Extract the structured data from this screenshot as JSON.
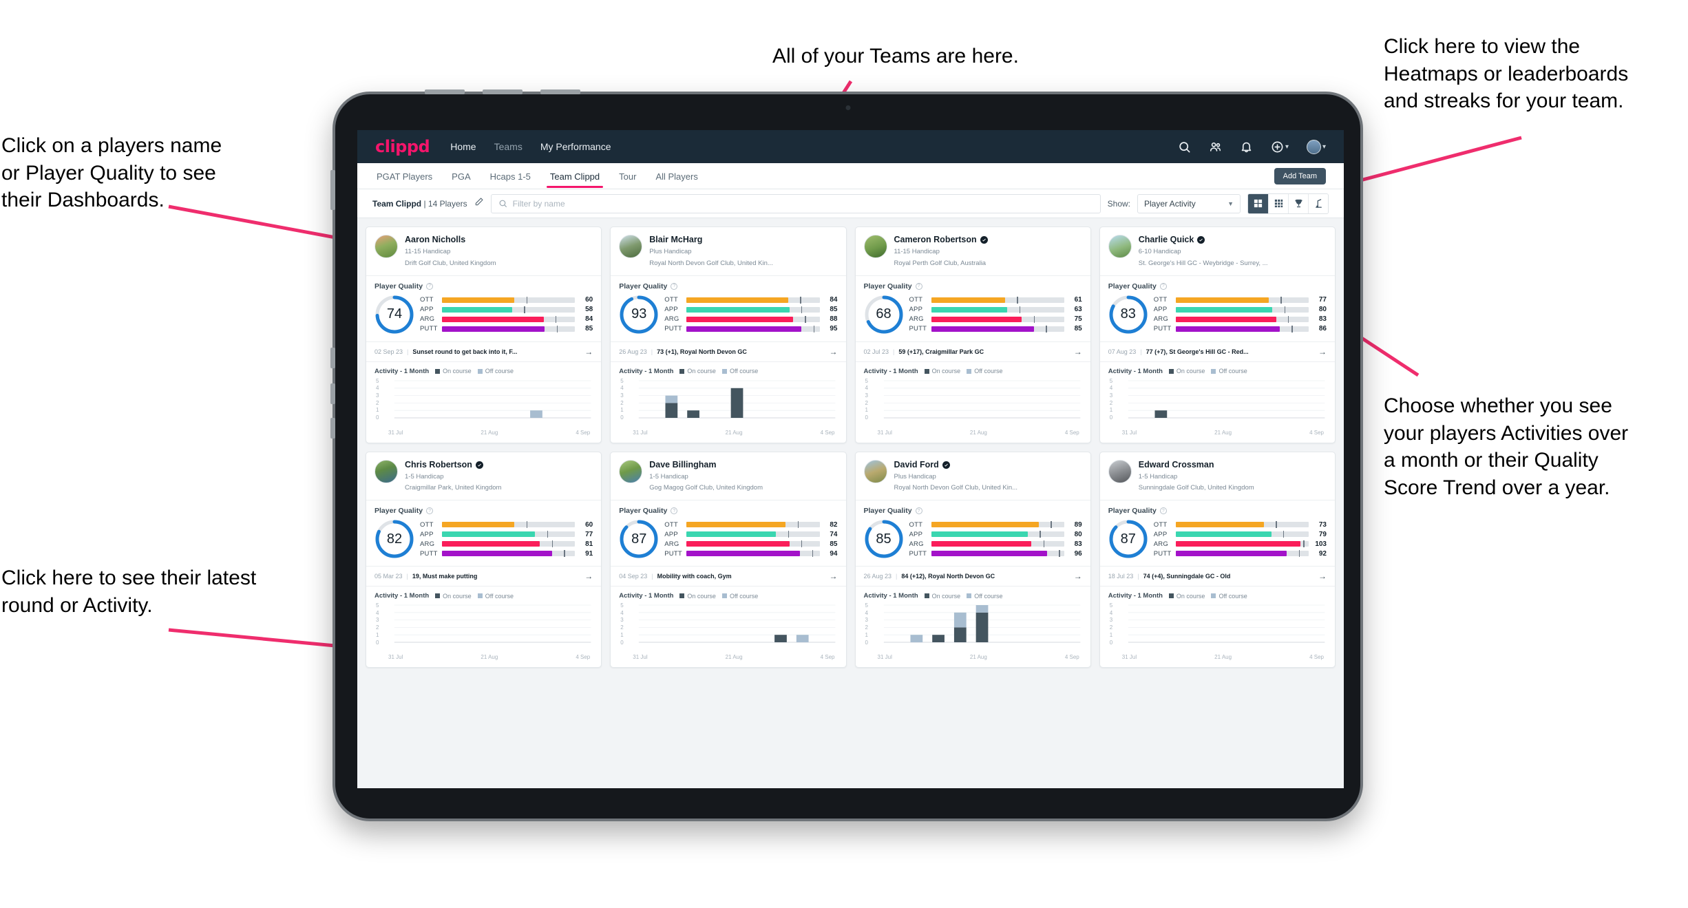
{
  "annotations": {
    "top": "All of your Teams are here.",
    "top_right": "Click here to view the\nHeatmaps or leaderboards\nand streaks for your team.",
    "top_left": "Click on a players name\nor Player Quality to see\ntheir Dashboards.",
    "bottom_left": "Click here to see their latest\nround or Activity.",
    "right": "Choose whether you see\nyour players Activities over\na month or their Quality\nScore Trend over a year.",
    "accent_color": "#ef2d6d"
  },
  "navbar": {
    "logo": "clippd",
    "links": [
      {
        "label": "Home",
        "active": true
      },
      {
        "label": "Teams",
        "active": false
      },
      {
        "label": "My Performance",
        "active": true
      }
    ],
    "icons": [
      "search-icon",
      "people-icon",
      "bell-icon",
      "plus-circle-icon",
      "avatar"
    ]
  },
  "tabs": [
    {
      "label": "PGAT Players",
      "active": false
    },
    {
      "label": "PGA",
      "active": false
    },
    {
      "label": "Hcaps 1-5",
      "active": false
    },
    {
      "label": "Team Clippd",
      "active": true
    },
    {
      "label": "Tour",
      "active": false
    },
    {
      "label": "All Players",
      "active": false
    }
  ],
  "add_team_label": "Add Team",
  "filterbar": {
    "team_name": "Team Clippd",
    "team_count": "| 14 Players",
    "search_placeholder": "Filter by name",
    "show_label": "Show:",
    "show_value": "Player Activity",
    "views": [
      {
        "name": "grid-view-icon",
        "active": true
      },
      {
        "name": "compact-grid-view-icon",
        "active": false
      },
      {
        "name": "trophy-view-icon",
        "active": false
      },
      {
        "name": "golfer-view-icon",
        "active": false
      }
    ]
  },
  "quality_section": {
    "title": "Player Quality",
    "metric_labels": [
      "OTT",
      "APP",
      "ARG",
      "PUTT"
    ],
    "metric_colors": [
      "#f5a623",
      "#3ad6b0",
      "#fa1e5a",
      "#a312c9"
    ]
  },
  "activity_section": {
    "title": "Activity - 1 Month",
    "legend_on": "On course",
    "legend_off": "Off course",
    "y_ticks": [
      "5",
      "4",
      "3",
      "2",
      "1",
      "0"
    ],
    "x_ticks": [
      "31 Jul",
      "21 Aug",
      "4 Sep"
    ],
    "color_on": "#44555f",
    "color_off": "#a8bdd0"
  },
  "players": [
    {
      "name": "Aaron Nicholls",
      "verified": false,
      "handicap": "11-15 Handicap",
      "club": "Drift Golf Club, United Kingdom",
      "avatar": "linear-gradient(160deg,#e8a07a 0%,#8fae5e 45%,#5f8a3e 100%)",
      "quality": 74,
      "metrics": [
        60,
        58,
        84,
        85
      ],
      "round_date": "02 Sep 23",
      "round_text": "Sunset round to get back into it, F...",
      "chart_data": {
        "type": "bar",
        "bins": 9,
        "on": [
          0,
          0,
          0,
          0,
          0,
          0,
          0,
          0,
          0
        ],
        "off": [
          0,
          0,
          0,
          0,
          0,
          0,
          1,
          0,
          0
        ]
      }
    },
    {
      "name": "Blair McHarg",
      "verified": false,
      "handicap": "Plus Handicap",
      "club": "Royal North Devon Golf Club, United Kin...",
      "avatar": "linear-gradient(160deg,#cfe0ea 0%,#7f9a6e 50%,#4c6b3d 100%)",
      "quality": 93,
      "metrics": [
        84,
        85,
        88,
        95
      ],
      "round_date": "26 Aug 23",
      "round_text": "73 (+1), Royal North Devon GC",
      "chart_data": {
        "type": "bar",
        "bins": 9,
        "on": [
          0,
          2,
          1,
          0,
          4,
          0,
          0,
          0,
          0
        ],
        "off": [
          0,
          1,
          0,
          0,
          0,
          0,
          0,
          0,
          0
        ]
      }
    },
    {
      "name": "Cameron Robertson",
      "verified": true,
      "handicap": "11-15 Handicap",
      "club": "Royal Perth Golf Club, Australia",
      "avatar": "linear-gradient(160deg,#9fbd6e 0%,#6f9a4a 55%,#3f6b2d 100%)",
      "quality": 68,
      "metrics": [
        61,
        63,
        75,
        85
      ],
      "round_date": "02 Jul 23",
      "round_text": "59 (+17), Craigmillar Park GC",
      "chart_data": {
        "type": "bar",
        "bins": 9,
        "on": [
          0,
          0,
          0,
          0,
          0,
          0,
          0,
          0,
          0
        ],
        "off": [
          0,
          0,
          0,
          0,
          0,
          0,
          0,
          0,
          0
        ]
      }
    },
    {
      "name": "Charlie Quick",
      "verified": true,
      "handicap": "6-10 Handicap",
      "club": "St. George's Hill GC - Weybridge - Surrey, ...",
      "avatar": "linear-gradient(160deg,#b9dcf0 0%,#8fb97e 55%,#5d8a46 100%)",
      "quality": 83,
      "metrics": [
        77,
        80,
        83,
        86
      ],
      "round_date": "07 Aug 23",
      "round_text": "77 (+7), St George's Hill GC - Red...",
      "chart_data": {
        "type": "bar",
        "bins": 9,
        "on": [
          0,
          1,
          0,
          0,
          0,
          0,
          0,
          0,
          0
        ],
        "off": [
          0,
          0,
          0,
          0,
          0,
          0,
          0,
          0,
          0
        ]
      }
    },
    {
      "name": "Chris Robertson",
      "verified": true,
      "handicap": "1-5 Handicap",
      "club": "Craigmillar Park, United Kingdom",
      "avatar": "linear-gradient(160deg,#8fb46a 0%,#5d8a46 40%,#3c6b8c 100%)",
      "quality": 82,
      "metrics": [
        60,
        77,
        81,
        91
      ],
      "round_date": "05 Mar 23",
      "round_text": "19, Must make putting",
      "chart_data": {
        "type": "bar",
        "bins": 9,
        "on": [
          0,
          0,
          0,
          0,
          0,
          0,
          0,
          0,
          0
        ],
        "off": [
          0,
          0,
          0,
          0,
          0,
          0,
          0,
          0,
          0
        ]
      }
    },
    {
      "name": "Dave Billingham",
      "verified": false,
      "handicap": "1-5 Handicap",
      "club": "Gog Magog Golf Club, United Kingdom",
      "avatar": "linear-gradient(160deg,#a8c87e 0%,#6f9a4a 45%,#4a7fae 100%)",
      "quality": 87,
      "metrics": [
        82,
        74,
        85,
        94
      ],
      "round_date": "04 Sep 23",
      "round_text": "Mobility with coach, Gym",
      "chart_data": {
        "type": "bar",
        "bins": 9,
        "on": [
          0,
          0,
          0,
          0,
          0,
          0,
          1,
          0,
          0
        ],
        "off": [
          0,
          0,
          0,
          0,
          0,
          0,
          0,
          1,
          0
        ]
      }
    },
    {
      "name": "David Ford",
      "verified": true,
      "handicap": "Plus Handicap",
      "club": "Royal North Devon Golf Club, United Kin...",
      "avatar": "linear-gradient(160deg,#9ec3de 0%,#b9a96e 50%,#7d8a4a 100%)",
      "quality": 85,
      "metrics": [
        89,
        80,
        83,
        96
      ],
      "round_date": "26 Aug 23",
      "round_text": "84 (+12), Royal North Devon GC",
      "chart_data": {
        "type": "bar",
        "bins": 9,
        "on": [
          0,
          0,
          1,
          2,
          4,
          0,
          0,
          0,
          0
        ],
        "off": [
          0,
          1,
          0,
          2,
          1,
          0,
          0,
          0,
          0
        ]
      }
    },
    {
      "name": "Edward Crossman",
      "verified": false,
      "handicap": "1-5 Handicap",
      "club": "Sunningdale Golf Club, United Kingdom",
      "avatar": "linear-gradient(160deg,#c9cdd1 0%,#8c8f93 50%,#55585c 100%)",
      "quality": 87,
      "metrics": [
        73,
        79,
        103,
        92
      ],
      "round_date": "18 Jul 23",
      "round_text": "74 (+4), Sunningdale GC - Old",
      "chart_data": {
        "type": "bar",
        "bins": 9,
        "on": [
          0,
          0,
          0,
          0,
          0,
          0,
          0,
          0,
          0
        ],
        "off": [
          0,
          0,
          0,
          0,
          0,
          0,
          0,
          0,
          0
        ]
      }
    }
  ]
}
